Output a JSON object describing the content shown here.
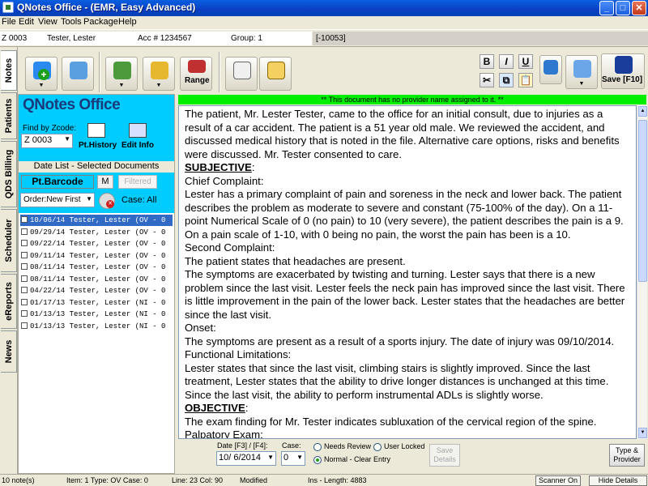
{
  "window": {
    "title": "QNotes Office - (EMR, Easy Advanced)",
    "controls": {
      "minimize": "_",
      "maximize": "□",
      "close": "✕"
    }
  },
  "menu": [
    "File",
    "Edit",
    "View",
    "Tools",
    "Package",
    "Help"
  ],
  "patient_bar": {
    "zcode": "Z 0003",
    "name": "Tester, Lester",
    "account": "Acc # 1234567",
    "group": "Group: 1",
    "doc_number": "[-10053]"
  },
  "side_tabs": [
    "Notes",
    "Patients",
    "QDS Billing",
    "Scheduler",
    "eReports",
    "News"
  ],
  "toolbar": {
    "range_label": "Range",
    "format": {
      "bold": "B",
      "italic": "I",
      "underline": "U"
    },
    "save_label": "Save [F10]",
    "icons": [
      "add-note-icon",
      "search-note-icon",
      "provider-icon",
      "document-list-icon",
      "calendar-range-icon",
      "edit-note-icon",
      "sign-note-icon",
      "cut-icon",
      "copy-icon",
      "paste-icon",
      "spell-check-icon",
      "print-icon",
      "save-icon"
    ]
  },
  "left_panel": {
    "app_title": "QNotes Office",
    "find_label": "Find by Zcode:",
    "zcode_value": "Z 0003",
    "pt_history": "Pt.History",
    "edit_info": "Edit Info",
    "date_list_label": "Date List - Selected Documents",
    "barcode": "Pt.Barcode",
    "m_button": "M",
    "filtered": "Filtered",
    "order": "Order:New First",
    "case": "Case: All",
    "documents": [
      "10/06/14 Tester, Lester (OV - 0",
      "09/29/14 Tester, Lester (OV - 0",
      "09/22/14 Tester, Lester (OV - 0",
      "09/11/14 Tester, Lester (OV - 0",
      "08/11/14 Tester, Lester (OV - 0",
      "08/11/14 Tester, Lester (OV - 0",
      "04/22/14 Tester, Lester (OV - 0",
      "01/17/13 Tester, Lester (NI - 0",
      "01/13/13 Tester, Lester (NI - 0",
      "01/13/13 Tester, Lester (NI - 0"
    ],
    "selected_index": 0
  },
  "notice": "** This document has no provider name assigned to it. **",
  "note": {
    "intro": "The patient, Mr. Lester Tester, came to the office for an initial consult, due to injuries as a result of a car accident. The patient is a 51 year old male. We reviewed the accident, and discussed medical history that is noted in the file. Alternative care options, risks and benefits were discussed. Mr. Tester consented to care.",
    "subjective_heading": "SUBJECTIVE",
    "chief_complaint_label": "Chief Complaint:",
    "chief_complaint": "Lester has a primary complaint of pain and soreness in the neck and lower back. The patient describes the problem as moderate to severe and constant (75-100% of the day). On a 11-point Numerical Scale of 0 (no pain) to 10 (very severe), the patient describes the pain is a 9. On a pain scale of 1-10, with 0 being no pain, the worst the pain has been is a 10.",
    "second_complaint_label": "Second Complaint:",
    "second_complaint": "The patient states that headaches are present.",
    "symptoms": "The symptoms are exacerbated by twisting and turning. Lester says that there is a new problem since the last visit. Lester feels the neck pain has improved since the last visit. There is little improvement in the pain of the lower back. Lester states that the headaches are better since the last visit.",
    "onset_label": "Onset:",
    "onset": "The symptoms are present as a result of a sports injury. The date of injury was 09/10/2014.",
    "functional_label": "Functional Limitations:",
    "functional": "Lester states that since the last visit, climbing stairs is slightly improved. Since the last treatment, Lester states that the ability to drive longer distances is unchanged at this time. Since the last visit, the ability to perform instrumental ADLs is slightly worse.",
    "objective_heading": "OBJECTIVE",
    "objective": "The exam finding for Mr. Tester indicates subluxation of the cervical region of the spine.",
    "palpatory_label": "Palpatory Exam:"
  },
  "bottom": {
    "date_label": "Date [F3] / [F4]:",
    "date_value": "10/ 6/2014",
    "case_label": "Case:",
    "case_value": "0",
    "needs_review": "Needs Review",
    "user_locked": "User Locked",
    "normal_clear": "Normal - Clear Entry",
    "save_details": "Save Details",
    "type_provider": "Type & Provider"
  },
  "status": {
    "notes_count": "10 note(s)",
    "item": "Item: 1 Type: OV Case: 0",
    "line_col": "Line: 23  Col: 90",
    "modified": "Modified",
    "ins_length": "Ins - Length: 4883",
    "scanner": "Scanner On",
    "hide_details": "Hide Details"
  }
}
